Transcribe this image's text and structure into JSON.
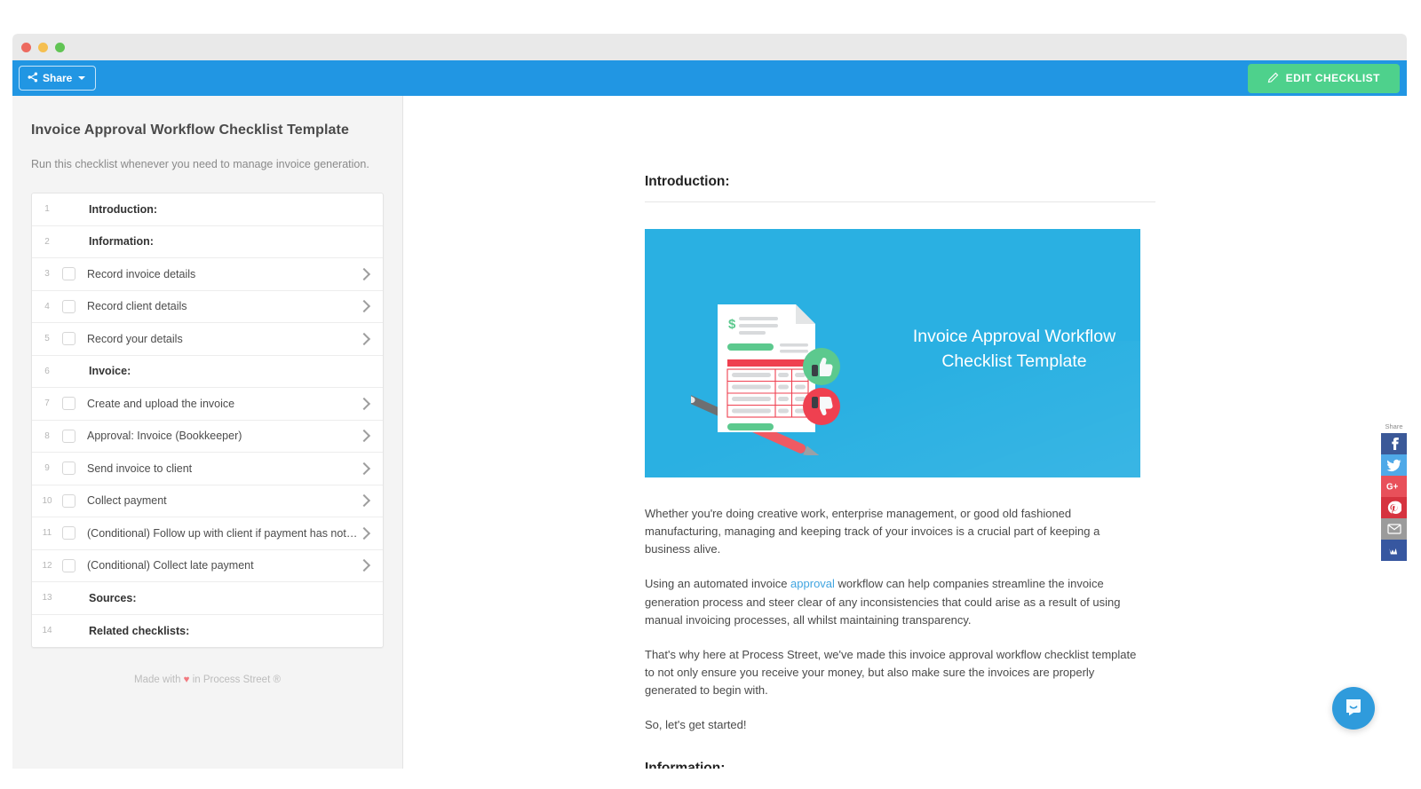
{
  "window": {
    "traffic_lights": [
      "close",
      "minimize",
      "zoom"
    ],
    "colors": {
      "appbar": "#2196e3",
      "accent_green": "#4ed18c",
      "hero_blue": "#2ab0e2",
      "link": "#41a5e0"
    }
  },
  "appbar": {
    "share_label": "Share",
    "share_icon": "share-nodes-icon",
    "edit_label": "EDIT CHECKLIST",
    "edit_icon": "pencil-icon"
  },
  "checklist": {
    "title": "Invoice Approval Workflow Checklist Template",
    "subtitle": "Run this checklist whenever you need to manage invoice generation.",
    "footer_prefix": "Made with",
    "footer_heart": "♥",
    "footer_suffix": "in Process Street ®",
    "tasks": [
      {
        "num": "1",
        "label": "Introduction:",
        "heading": true,
        "checked": false
      },
      {
        "num": "2",
        "label": "Information:",
        "heading": true,
        "checked": false
      },
      {
        "num": "3",
        "label": "Record invoice details",
        "heading": false,
        "checked": false
      },
      {
        "num": "4",
        "label": "Record client details",
        "heading": false,
        "checked": false
      },
      {
        "num": "5",
        "label": "Record your details",
        "heading": false,
        "checked": false
      },
      {
        "num": "6",
        "label": "Invoice:",
        "heading": true,
        "checked": false
      },
      {
        "num": "7",
        "label": "Create and upload the invoice",
        "heading": false,
        "checked": false
      },
      {
        "num": "8",
        "label": "Approval: Invoice (Bookkeeper)",
        "heading": false,
        "checked": false
      },
      {
        "num": "9",
        "label": "Send invoice to client",
        "heading": false,
        "checked": false
      },
      {
        "num": "10",
        "label": "Collect payment",
        "heading": false,
        "checked": false
      },
      {
        "num": "11",
        "label": "(Conditional) Follow up with client if payment has not ye…",
        "heading": false,
        "checked": false
      },
      {
        "num": "12",
        "label": "(Conditional) Collect late payment",
        "heading": false,
        "checked": false
      },
      {
        "num": "13",
        "label": "Sources:",
        "heading": true,
        "checked": false
      },
      {
        "num": "14",
        "label": "Related checklists:",
        "heading": true,
        "checked": false
      }
    ]
  },
  "main": {
    "heading_intro": "Introduction:",
    "heading_information": "Information:",
    "hero_title_line1": "Invoice Approval Workflow",
    "hero_title_line2": "Checklist Template",
    "paragraph_1": "Whether you're doing creative work, enterprise management, or good old fashioned manufacturing, managing and keeping track of your invoices is a crucial part of keeping a business alive.",
    "paragraph_2_before": "Using an automated invoice ",
    "paragraph_2_link": "approval",
    "paragraph_2_after": " workflow can help companies streamline the invoice generation process and steer clear of any inconsistencies that could arise as a result of using manual invoicing processes, all whilst maintaining transparency.",
    "paragraph_3": "That's why here at Process Street, we've made this invoice approval workflow checklist template to not only ensure you receive your money, but also make sure the invoices are properly generated to begin with.",
    "paragraph_4": "So, let's get started!"
  },
  "share_rail": {
    "label": "Share",
    "buttons": [
      {
        "name": "facebook",
        "color": "#3b5998"
      },
      {
        "name": "twitter",
        "color": "#4fa9e8"
      },
      {
        "name": "googleplus",
        "color": "#e8505a"
      },
      {
        "name": "pinterest",
        "color": "#d6333f"
      },
      {
        "name": "email",
        "color": "#9b9b9b"
      },
      {
        "name": "vk",
        "color": "#3757a0"
      }
    ]
  },
  "intercom": {
    "icon": "chat-smiley-icon"
  }
}
